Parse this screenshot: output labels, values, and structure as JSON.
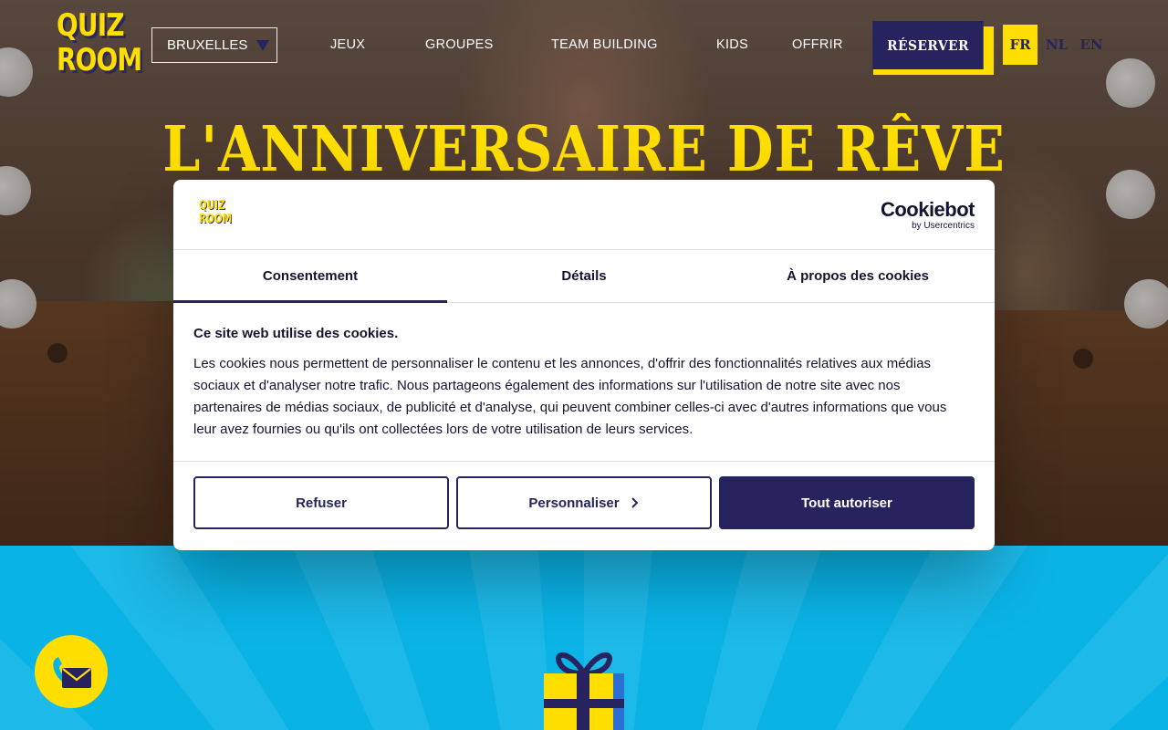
{
  "header": {
    "logo_line1": "QUIZ",
    "logo_line2": "ROOM",
    "city": "BRUXELLES",
    "nav": [
      "JEUX",
      "GROUPES",
      "TEAM BUILDING",
      "KIDS",
      "OFFRIR"
    ],
    "reserve_label": "RÉSERVER",
    "languages": [
      "FR",
      "NL",
      "EN"
    ],
    "active_language": "FR"
  },
  "hero": {
    "title": "L'ANNIVERSAIRE DE RÊVE"
  },
  "cookie": {
    "logo_line1": "QUIZ",
    "logo_line2": "ROOM",
    "brand": "Cookiebot",
    "brand_sub": "by Usercentrics",
    "tabs": [
      "Consentement",
      "Détails",
      "À propos des cookies"
    ],
    "active_tab": "Consentement",
    "heading": "Ce site web utilise des cookies.",
    "body": "Les cookies nous permettent de personnaliser le contenu et les annonces, d'offrir des fonctionnalités relatives aux médias sociaux et d'analyser notre trafic. Nous partageons également des informations sur l'utilisation de notre site avec nos partenaires de médias sociaux, de publicité et d'analyse, qui peuvent combiner celles-ci avec d'autres informations que vous leur avez fournies ou qu'ils ont collectées lors de votre utilisation de leurs services.",
    "buttons": {
      "refuse": "Refuser",
      "customize": "Personnaliser",
      "accept_all": "Tout autoriser"
    }
  },
  "colors": {
    "brand_navy": "#26235e",
    "brand_yellow": "#ffde00",
    "section_blue": "#0ab3e6"
  },
  "icons": {
    "contact": "phone-mail-icon",
    "gift": "gift-icon",
    "dropdown": "triangle-down-icon",
    "customize_arrow": "chevron-right-icon"
  }
}
